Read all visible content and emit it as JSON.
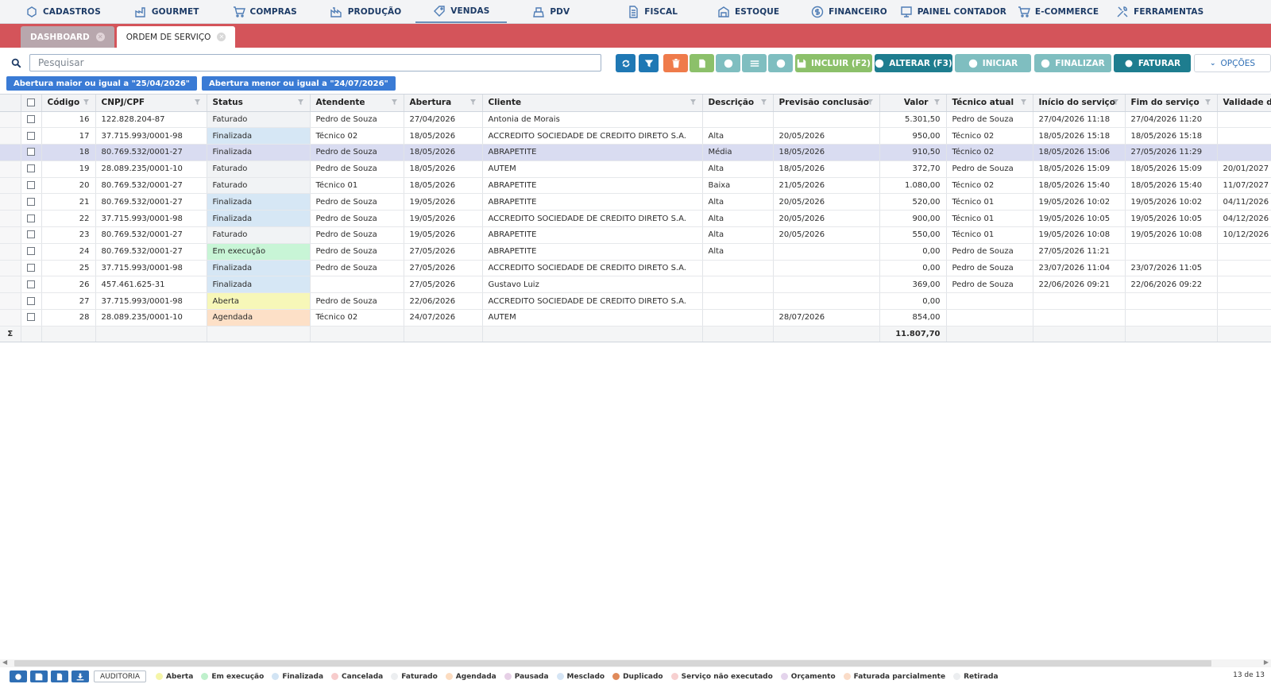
{
  "menu": [
    {
      "label": "CADASTROS",
      "icon": "box-icon"
    },
    {
      "label": "GOURMET",
      "icon": "factory-icon"
    },
    {
      "label": "COMPRAS",
      "icon": "cart-icon"
    },
    {
      "label": "PRODUÇÃO",
      "icon": "industry-icon"
    },
    {
      "label": "VENDAS",
      "icon": "tag-icon"
    },
    {
      "label": "PDV",
      "icon": "register-icon"
    },
    {
      "label": "FISCAL",
      "icon": "document-icon"
    },
    {
      "label": "ESTOQUE",
      "icon": "warehouse-icon"
    },
    {
      "label": "FINANCEIRO",
      "icon": "dollar-icon"
    },
    {
      "label": "PAINEL CONTADOR",
      "icon": "monitor-icon"
    },
    {
      "label": "E-COMMERCE",
      "icon": "cart-icon"
    },
    {
      "label": "FERRAMENTAS",
      "icon": "tools-icon"
    }
  ],
  "tabs": [
    {
      "label": "DASHBOARD"
    },
    {
      "label": "ORDEM DE SERVIÇO"
    }
  ],
  "search": {
    "placeholder": "Pesquisar"
  },
  "toolbar": {
    "incluir": "INCLUIR (F2)",
    "alterar": "ALTERAR (F3)",
    "iniciar": "INICIAR",
    "finalizar": "FINALIZAR",
    "faturar": "FATURAR",
    "opcoes": "OPÇÕES"
  },
  "filters": [
    "Abertura maior ou igual a \"25/04/2026\"",
    "Abertura menor ou igual a \"24/07/2026\""
  ],
  "columns": [
    "Código",
    "CNPJ/CPF",
    "Status",
    "Atendente",
    "Abertura",
    "Cliente",
    "Descrição",
    "Previsão conclusão",
    "Valor",
    "Técnico atual",
    "Início do serviço",
    "Fim do serviço",
    "Validade da g"
  ],
  "rows": [
    [
      "16",
      "122.828.204-87",
      "Faturado",
      "Pedro de Souza",
      "27/04/2026",
      "Antonia de Morais",
      "",
      "",
      "5.301,50",
      "Pedro de Souza",
      "27/04/2026 11:18",
      "27/04/2026 11:20",
      ""
    ],
    [
      "17",
      "37.715.993/0001-98",
      "Finalizada",
      "Técnico 02",
      "18/05/2026",
      "ACCREDITO SOCIEDADE DE CREDITO DIRETO S.A.",
      "Alta",
      "20/05/2026",
      "950,00",
      "Técnico 02",
      "18/05/2026 15:18",
      "18/05/2026 15:18",
      ""
    ],
    [
      "18",
      "80.769.532/0001-27",
      "Finalizada",
      "Pedro de Souza",
      "18/05/2026",
      "ABRAPETITE",
      "Média",
      "18/05/2026",
      "910,50",
      "Técnico 02",
      "18/05/2026 15:06",
      "27/05/2026 11:29",
      ""
    ],
    [
      "19",
      "28.089.235/0001-10",
      "Faturado",
      "Pedro de Souza",
      "18/05/2026",
      "AUTEM",
      "Alta",
      "18/05/2026",
      "372,70",
      "Pedro de Souza",
      "18/05/2026 15:09",
      "18/05/2026 15:09",
      "20/01/2027"
    ],
    [
      "20",
      "80.769.532/0001-27",
      "Faturado",
      "Técnico 01",
      "18/05/2026",
      "ABRAPETITE",
      "Baixa",
      "21/05/2026",
      "1.080,00",
      "Técnico 02",
      "18/05/2026 15:40",
      "18/05/2026 15:40",
      "11/07/2027"
    ],
    [
      "21",
      "80.769.532/0001-27",
      "Finalizada",
      "Pedro de Souza",
      "19/05/2026",
      "ABRAPETITE",
      "Alta",
      "20/05/2026",
      "520,00",
      "Técnico 01",
      "19/05/2026 10:02",
      "19/05/2026 10:02",
      "04/11/2026"
    ],
    [
      "22",
      "37.715.993/0001-98",
      "Finalizada",
      "Pedro de Souza",
      "19/05/2026",
      "ACCREDITO SOCIEDADE DE CREDITO DIRETO S.A.",
      "Alta",
      "20/05/2026",
      "900,00",
      "Técnico 01",
      "19/05/2026 10:05",
      "19/05/2026 10:05",
      "04/12/2026"
    ],
    [
      "23",
      "80.769.532/0001-27",
      "Faturado",
      "Pedro de Souza",
      "19/05/2026",
      "ABRAPETITE",
      "Alta",
      "20/05/2026",
      "550,00",
      "Técnico 01",
      "19/05/2026 10:08",
      "19/05/2026 10:08",
      "10/12/2026"
    ],
    [
      "24",
      "80.769.532/0001-27",
      "Em execução",
      "Pedro de Souza",
      "27/05/2026",
      "ABRAPETITE",
      "Alta",
      "",
      "0,00",
      "Pedro de Souza",
      "27/05/2026 11:21",
      "",
      ""
    ],
    [
      "25",
      "37.715.993/0001-98",
      "Finalizada",
      "Pedro de Souza",
      "27/05/2026",
      "ACCREDITO SOCIEDADE DE CREDITO DIRETO S.A.",
      "",
      "",
      "0,00",
      "Pedro de Souza",
      "23/07/2026 11:04",
      "23/07/2026 11:05",
      ""
    ],
    [
      "26",
      "457.461.625-31",
      "Finalizada",
      "",
      "27/05/2026",
      "Gustavo Luiz",
      "",
      "",
      "369,00",
      "Pedro de Souza",
      "22/06/2026 09:21",
      "22/06/2026 09:22",
      ""
    ],
    [
      "27",
      "37.715.993/0001-98",
      "Aberta",
      "Pedro de Souza",
      "22/06/2026",
      "ACCREDITO SOCIEDADE DE CREDITO DIRETO S.A.",
      "",
      "",
      "0,00",
      "",
      "",
      "",
      ""
    ],
    [
      "28",
      "28.089.235/0001-10",
      "Agendada",
      "Técnico 02",
      "24/07/2026",
      "AUTEM",
      "",
      "28/07/2026",
      "854,00",
      "",
      "",
      "",
      ""
    ]
  ],
  "sum": {
    "symbol": "Σ",
    "valor": "11.807,70"
  },
  "footer": {
    "auditoria": "AUDITORIA",
    "legend": [
      {
        "label": "Aberta",
        "color": "#f5f5a8"
      },
      {
        "label": "Em execução",
        "color": "#bff0cc"
      },
      {
        "label": "Finalizada",
        "color": "#d2e4f4"
      },
      {
        "label": "Cancelada",
        "color": "#f7cccc"
      },
      {
        "label": "Faturado",
        "color": "#eceef0"
      },
      {
        "label": "Agendada",
        "color": "#fcdcc0"
      },
      {
        "label": "Pausada",
        "color": "#e6d0e6"
      },
      {
        "label": "Mesclado",
        "color": "#d5e5f5"
      },
      {
        "label": "Duplicado",
        "color": "#e08a5a"
      },
      {
        "label": "Serviço não executado",
        "color": "#f7d0d0"
      },
      {
        "label": "Orçamento",
        "color": "#e4d4ec"
      },
      {
        "label": "Faturada parcialmente",
        "color": "#fadcc8"
      },
      {
        "label": "Retirada",
        "color": "#eceef0"
      }
    ],
    "pager": "13 de 13"
  }
}
